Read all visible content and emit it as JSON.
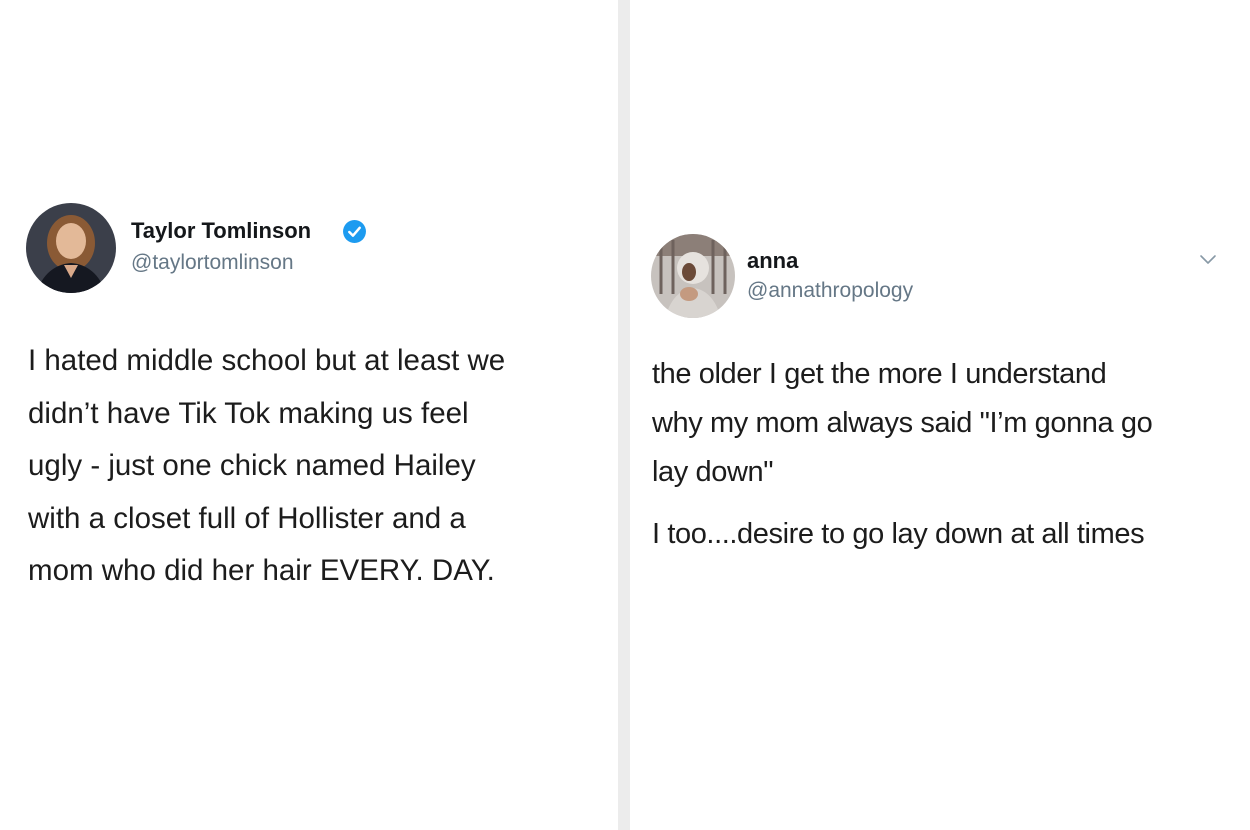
{
  "left_tweet": {
    "author_name": "Taylor Tomlinson",
    "author_handle": "@taylortomlinson",
    "verified_icon": "verified-badge-icon",
    "verified_color": "#1d9bf0",
    "avatar_icon": "profile-photo",
    "text_lines": [
      "I hated middle school but at least we",
      "didn’t have Tik Tok making us feel",
      "ugly - just one chick named Hailey",
      "with a closet full of Hollister and a",
      "mom who did her hair EVERY. DAY."
    ]
  },
  "right_tweet": {
    "author_name": "anna",
    "author_handle": "@annathropology",
    "avatar_icon": "profile-photo",
    "menu_icon": "chevron-down-icon",
    "paragraph_1_lines": [
      "the older I get the more I understand",
      "why my mom always said \"I’m gonna go",
      "lay down\""
    ],
    "paragraph_2_lines": [
      "I too....desire to go lay down at all times"
    ]
  },
  "colors": {
    "divider": "#ececec",
    "handle": "#657786",
    "text": "#1c1c1c"
  }
}
